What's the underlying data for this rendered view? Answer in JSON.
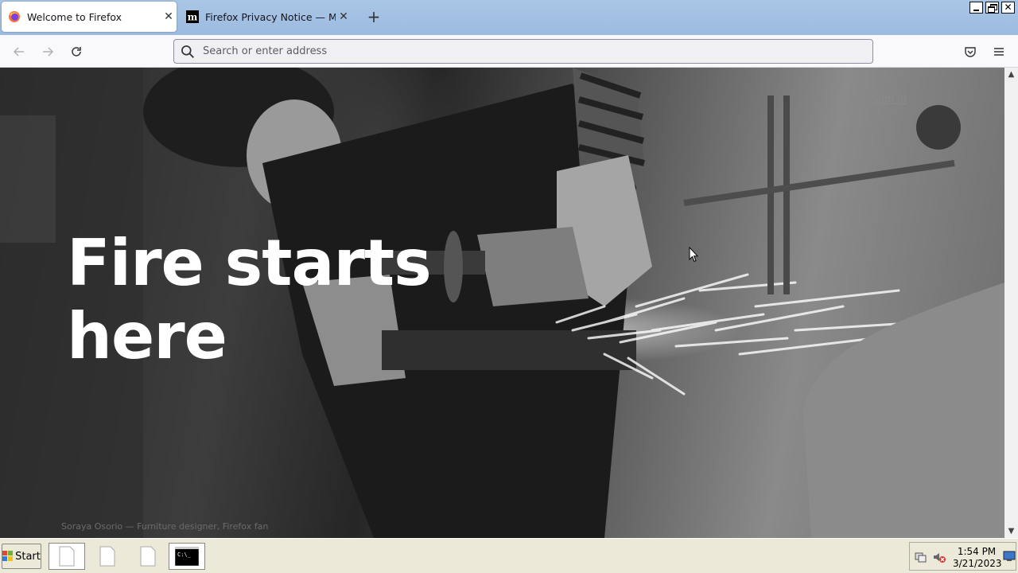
{
  "browser": {
    "tabs": [
      {
        "title": "Welcome to Firefox",
        "active": true,
        "icon": "firefox-icon"
      },
      {
        "title": "Firefox Privacy Notice — Mozilla",
        "active": false,
        "icon": "mozilla-m-icon"
      }
    ],
    "new_tab_icon": "plus-icon"
  },
  "navbar": {
    "back_icon": "back-arrow-icon",
    "forward_icon": "forward-arrow-icon",
    "reload_icon": "reload-icon",
    "search_placeholder": "Search or enter address",
    "pocket_icon": "pocket-icon",
    "menu_icon": "hamburger-menu-icon"
  },
  "page": {
    "headline_line1": "Fire starts",
    "headline_line2": "here",
    "sign_in": "Sign in",
    "photo_credit": "Soraya Osorio — Furniture designer, Firefox fan"
  },
  "taskbar": {
    "start_label": "Start",
    "tasks": [
      "document-icon",
      "document-icon",
      "document-icon",
      "terminal-icon"
    ],
    "time": "1:54 PM",
    "date": "3/21/2023"
  },
  "colors": {
    "tabstrip": "#a9c6e6",
    "urlbar_border": "#8f8f9d",
    "taskbar": "#ece9d8",
    "headline": "#ffffff"
  }
}
